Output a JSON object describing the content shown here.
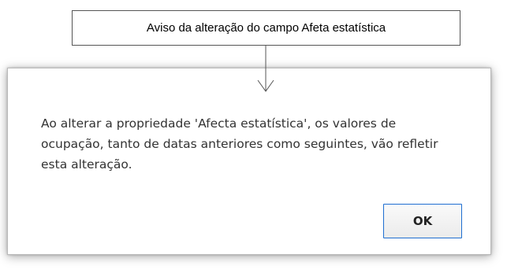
{
  "callout": {
    "text": "Aviso da alteração do campo Afeta estatística"
  },
  "dialog": {
    "message": "Ao alterar a propriedade 'Afecta estatística', os valores de ocupação, tanto de datas anteriores como seguintes, vão refletir esta alteração.",
    "ok_label": "OK"
  },
  "icons": {
    "pointer": "down-arrow-icon"
  },
  "colors": {
    "button_border": "#1f6fd1",
    "message_text": "#333333"
  }
}
